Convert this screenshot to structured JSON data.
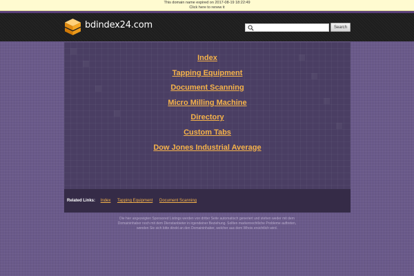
{
  "notice": {
    "line1": "This domain name expired on 2017-08-19 18:22:49",
    "line2": "Click here to renew it"
  },
  "header": {
    "site_name": "bdindex24.com",
    "logo_icon": "orange-stacked-box-icon",
    "search": {
      "placeholder": "",
      "value": "",
      "button_label": "Search"
    }
  },
  "main": {
    "links": [
      "Index",
      "Tapping Equipment",
      "Document Scanning",
      "Micro Milling Machine",
      "Directory",
      "Custom Tabs",
      "Dow Jones Industrial Average"
    ]
  },
  "related": {
    "title": "Related Links:",
    "links": [
      "Index",
      "Tapping Equipment",
      "Document Scanning"
    ]
  },
  "footer": {
    "line1": "Die hier angezeigten Sponsored Listings werden von dritter Seite automatisch generiert und stehen weder mit dem",
    "line2": "Domaininhaber noch mit dem Dienstanbieter in irgendeiner Beziehung. Sollten markenrechtliche Probleme auftreten,",
    "line3": "wenden Sie sich bitte direkt an den Domaininhaber, welcher aus dem Whois ersichtlich wird."
  },
  "colors": {
    "page_background": "#6a5a8a",
    "header_background": "#1e1e1e",
    "panel_background": "#4a3e63",
    "related_background": "#352b47",
    "link_color": "#f6b34a",
    "notice_background": "#fffbd0"
  }
}
